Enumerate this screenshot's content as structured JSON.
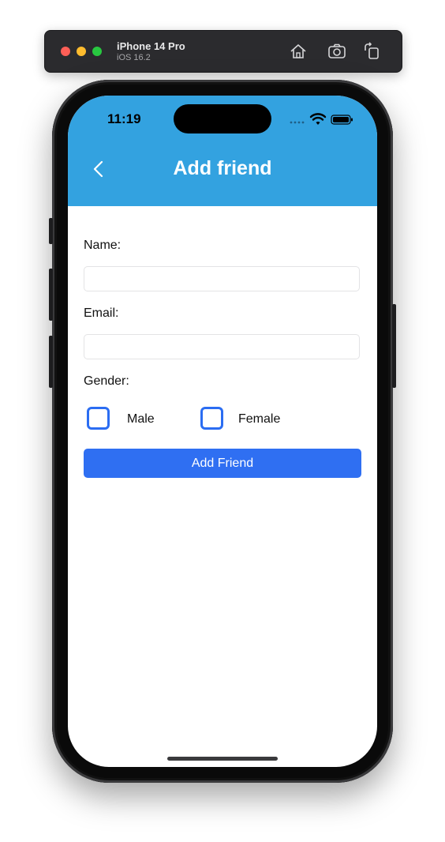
{
  "simulator": {
    "device_name": "iPhone 14 Pro",
    "os_version": "iOS 16.2",
    "icons": [
      "home-icon",
      "screenshot-icon",
      "rotate-icon"
    ]
  },
  "status_bar": {
    "time": "11:19",
    "icons": [
      "cellular-icon",
      "wifi-icon",
      "battery-icon"
    ]
  },
  "header": {
    "title": "Add friend",
    "back_icon": "chevron-left-icon",
    "background": "#33a2e0"
  },
  "form": {
    "name_label": "Name:",
    "name_value": "",
    "email_label": "Email:",
    "email_value": "",
    "gender_label": "Gender:",
    "gender_options": [
      {
        "label": "Male",
        "checked": false
      },
      {
        "label": "Female",
        "checked": false
      }
    ],
    "submit_label": "Add Friend"
  },
  "colors": {
    "accent": "#2f6ff2",
    "checkbox_border": "#2b6df2"
  }
}
